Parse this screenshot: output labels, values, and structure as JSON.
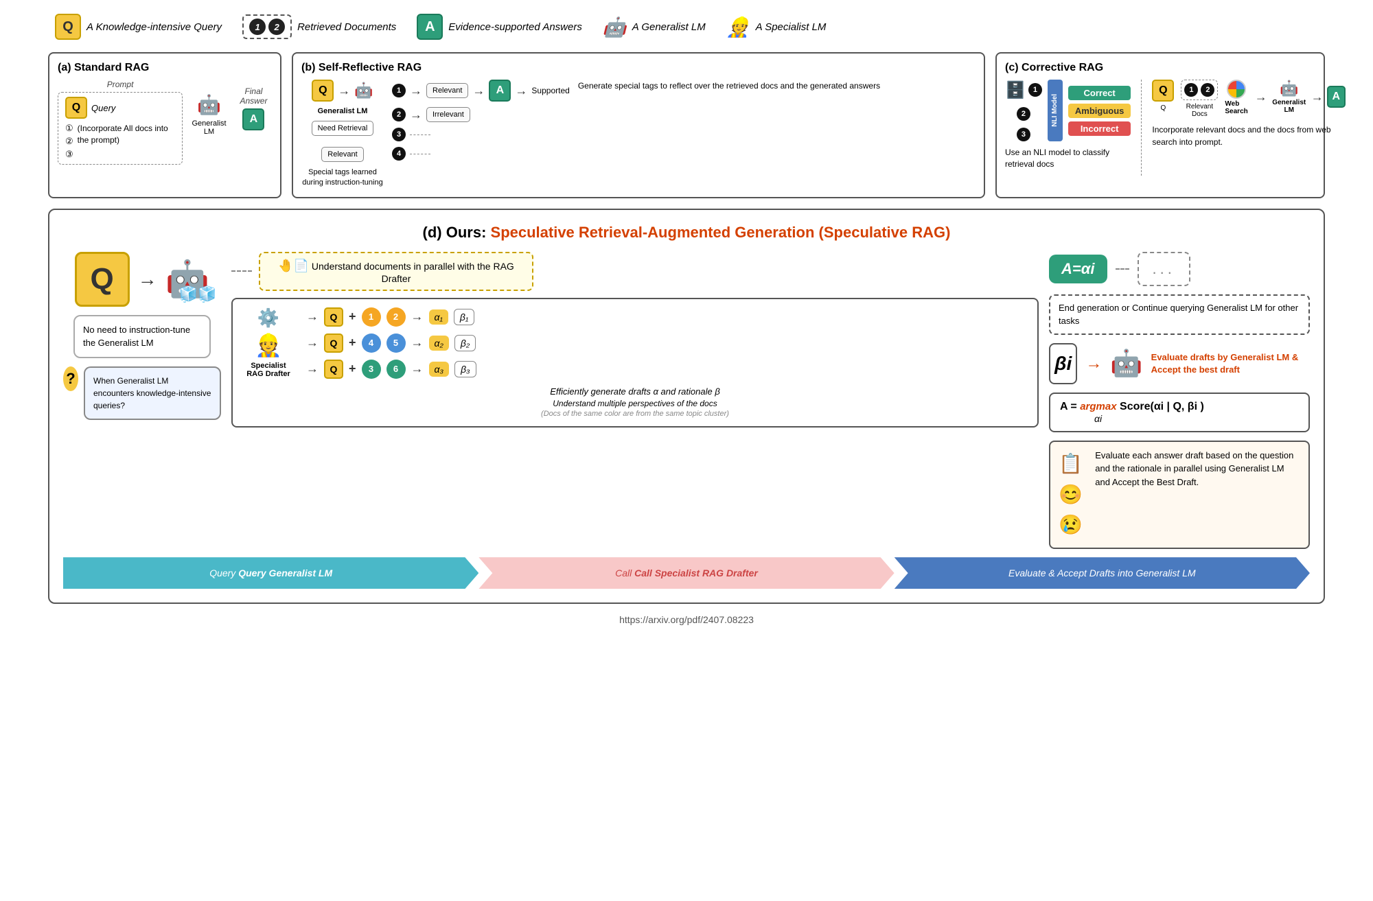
{
  "legend": {
    "q_label": "Q",
    "q_desc": "A Knowledge-intensive Query",
    "docs_nums": [
      "1",
      "2"
    ],
    "docs_desc": "Retrieved Documents",
    "a_label": "A",
    "a_desc": "Evidence-supported Answers",
    "generalist_desc": "A Generalist LM",
    "specialist_desc": "A Specialist LM"
  },
  "panel_a": {
    "title": "(a) Standard RAG",
    "prompt_label": "Prompt",
    "query_label": "Query",
    "q": "Q",
    "nums": [
      "①",
      "②",
      "③"
    ],
    "incorporate_text": "(Incorporate All docs into the prompt)",
    "generalist_label": "Generalist LM",
    "final_answer": "Final Answer",
    "a_label": "A"
  },
  "panel_b": {
    "title": "(b) Self-Reflective RAG",
    "q": "Q",
    "need_retrieval": "Need Retrieval",
    "generalist_lm": "Generalist LM",
    "num1": "①",
    "num2": "②",
    "num3": "③",
    "num4": "④",
    "relevant": "Relevant",
    "irrelevant": "Irrelevant",
    "a_label": "A",
    "supported": "Supported",
    "relevant_tag": "Relevant",
    "special_tags_desc": "Special tags learned during instruction-tuning",
    "generate_desc": "Generate special tags to reflect over the retrieved docs and the generated answers"
  },
  "panel_c": {
    "title": "(c) Corrective RAG",
    "num1": "①",
    "num2": "②",
    "num3": "③",
    "nli_model": "NLI Model",
    "correct": "Correct",
    "ambiguous": "Ambiguous",
    "incorrect": "Incorrect",
    "nli_desc": "Use an NLI model to classify retrieval docs",
    "q_label": "Q",
    "relevant_docs": "Relevant Docs",
    "web_search": "Web Search",
    "generalist_lm": "Generalist LM",
    "a_label": "A",
    "right_desc": "Incorporate relevant docs and the docs from web search into prompt."
  },
  "panel_d": {
    "title_prefix": "(d) Ours: ",
    "title_main": "Speculative Retrieval-Augmented Generation (Speculative RAG)",
    "q": "Q",
    "understand_text": "Understand documents in parallel with the RAG Drafter",
    "specialist_label": "Specialist RAG Drafter",
    "row1_docs": [
      "1",
      "2"
    ],
    "row2_docs": [
      "4",
      "5"
    ],
    "row3_docs": [
      "3",
      "6"
    ],
    "alpha1": "α₁",
    "beta1": "β₁",
    "alpha2": "α₂",
    "beta2": "β₂",
    "alpha3": "α₃",
    "beta3": "β₃",
    "alpha_eq": "A=αi",
    "beta_i": "βi",
    "efficiently_text": "Efficiently generate drafts α and rationale β",
    "multiple_text": "Understand multiple perspectives of the docs",
    "cluster_text": "(Docs of the same color are from the same topic cluster)",
    "no_need_text": "No need to instruction-tune the Generalist LM",
    "when_text": "When Generalist LM encounters knowledge-intensive queries?",
    "dots": "...",
    "continue_text": "End generation or Continue querying Generalist LM for other tasks",
    "evaluate_title": "Evaluate drafts by Generalist LM & Accept the best draft",
    "formula": "A = argmax Score(αi | Q, βi )",
    "formula_sub": "αi",
    "evaluate_desc": "Evaluate each answer draft based on the question and the rationale in parallel using Generalist LM and Accept the Best Draft.",
    "footer1": "Query Generalist LM",
    "footer2": "Call Specialist RAG Drafter",
    "footer3": "Evaluate & Accept Drafts into Generalist LM"
  },
  "url": "https://arxiv.org/pdf/2407.08223"
}
